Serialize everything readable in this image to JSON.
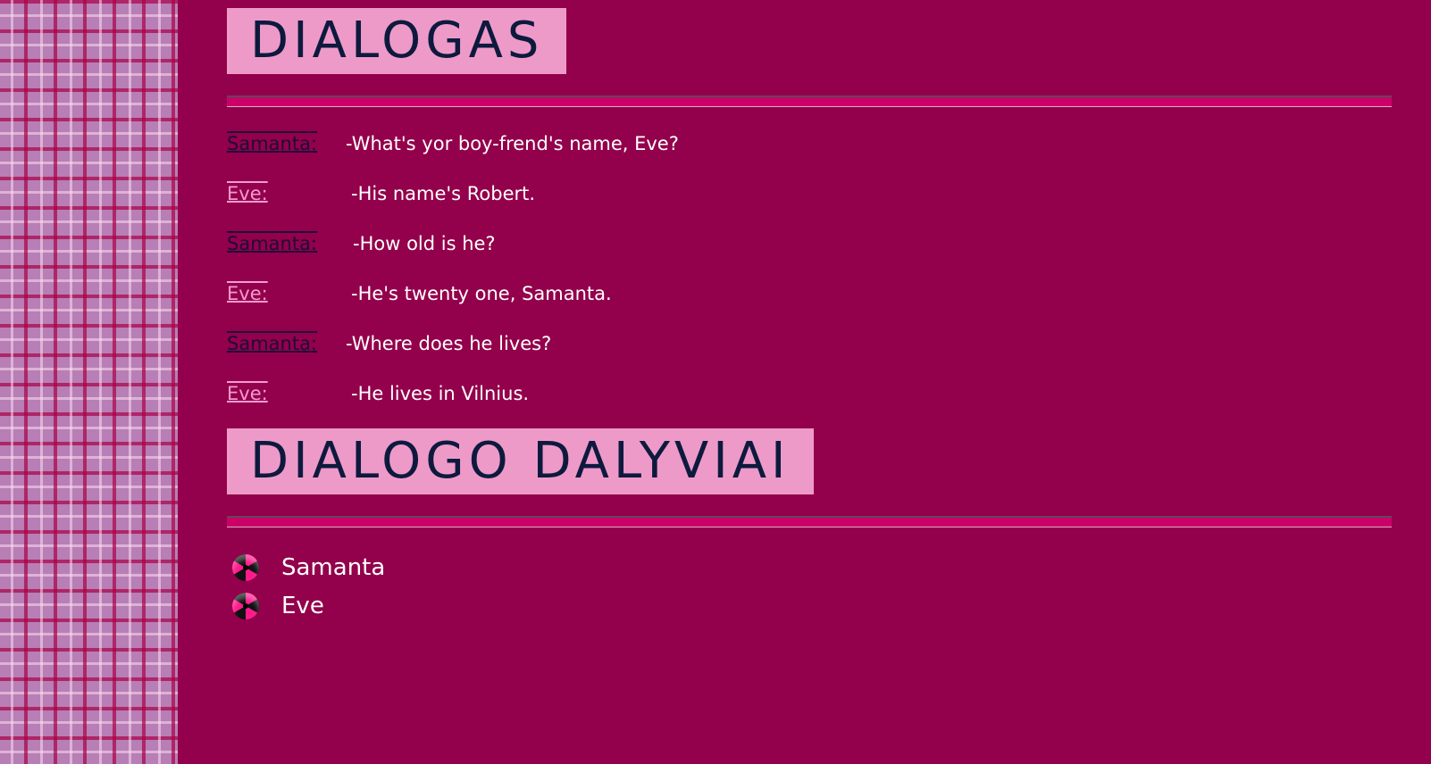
{
  "section1": {
    "title": "DIALOGAS"
  },
  "dialog": [
    {
      "speaker": "Samanta:",
      "line": "-What's yor boy-frend's name, Eve?"
    },
    {
      "speaker": "Eve:",
      "line": "-His name's Robert."
    },
    {
      "speaker": "Samanta:",
      "line": "-How old is he?"
    },
    {
      "speaker": "Eve:",
      "line": "-He's twenty one, Samanta."
    },
    {
      "speaker": "Samanta:",
      "line": "-Where does he lives?"
    },
    {
      "speaker": "Eve:",
      "line": "-He lives in Vilnius."
    }
  ],
  "section2": {
    "title": "DIALOGO DALYVIAI",
    "participants": [
      "Samanta",
      "Eve"
    ]
  },
  "colors": {
    "background": "#93004b",
    "heading_bg": "#ee9ac9",
    "rule": "#cc0069"
  }
}
